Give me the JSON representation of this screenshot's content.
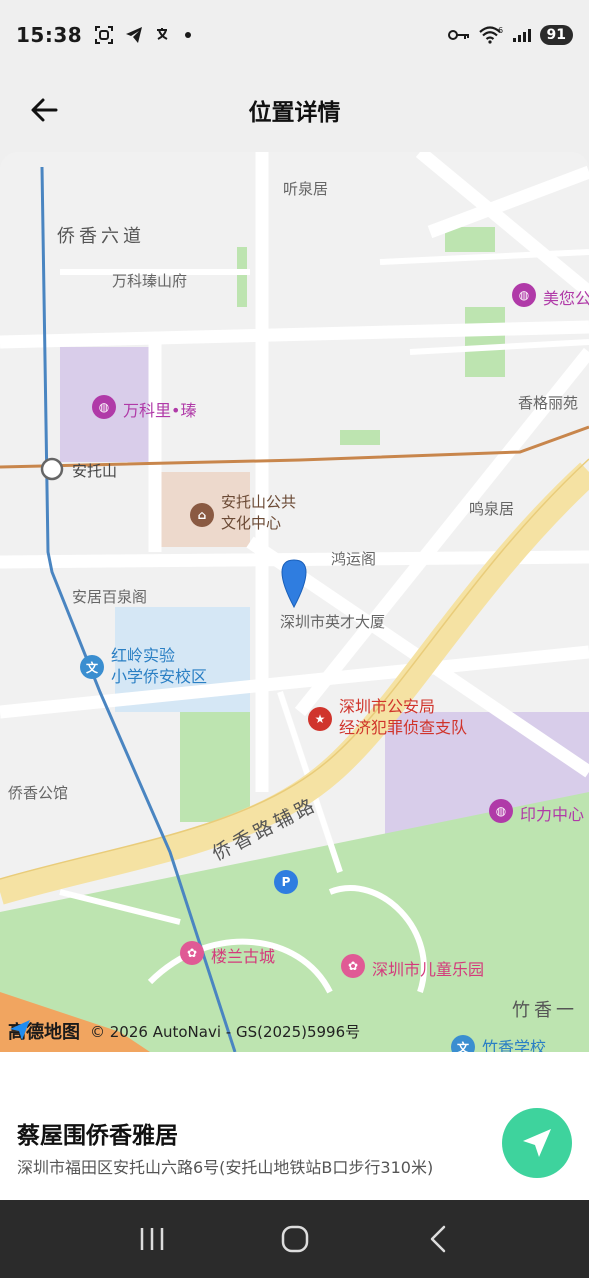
{
  "status_bar": {
    "time": "15:38",
    "battery": "91",
    "signal_badge": "6"
  },
  "header": {
    "title": "位置详情"
  },
  "map": {
    "labels": {
      "tingquanju": "听泉居",
      "qiaoxiang_liudao": "侨香六道",
      "vanke_zhenshanfu": "万科瑧山府",
      "meini": "美您公",
      "vanke_li": "万科里•瑧",
      "xiangge_liyuan": "香格丽苑",
      "antuoshan": "安托山",
      "culture_center": "安托山公共\n文化中心",
      "mingquanju": "鸣泉居",
      "hongyunge": "鸿运阁",
      "anju_baiquange": "安居百泉阁",
      "yingcai_dasha": "深圳市英才大厦",
      "hongling_school": "红岭实验\n小学侨安校区",
      "police": "深圳市公安局\n经济犯罪侦查支队",
      "qiaoxiang_gongguan": "侨香公馆",
      "qiaoxiang_road": "侨香路辅路",
      "yinli_center": "印力中心",
      "loulan_gucheng": "楼兰古城",
      "children_park": "深圳市儿童乐园",
      "zhuxiang": "竹香一",
      "zhuxiang_school": "竹香学校"
    },
    "parking_glyph": "P",
    "attribution_logo": "高德地图",
    "attribution_text": "© 2026 AutoNavi - GS(2025)5996号"
  },
  "place": {
    "name": "蔡屋围侨香雅居",
    "address": "深圳市福田区安托山六路6号(安托山地铁站B口步行310米)"
  },
  "icons": {
    "back": "arrow-left-icon",
    "navigate": "navigation-arrow-icon",
    "recent": "recent-apps-icon",
    "home": "home-icon",
    "back_nav": "back-chevron-icon"
  },
  "colors": {
    "accent": "#3ed39d",
    "marker": "#2f7de0",
    "poi_purple": "#b03aa8",
    "nav_bar": "#2b2b2b"
  }
}
